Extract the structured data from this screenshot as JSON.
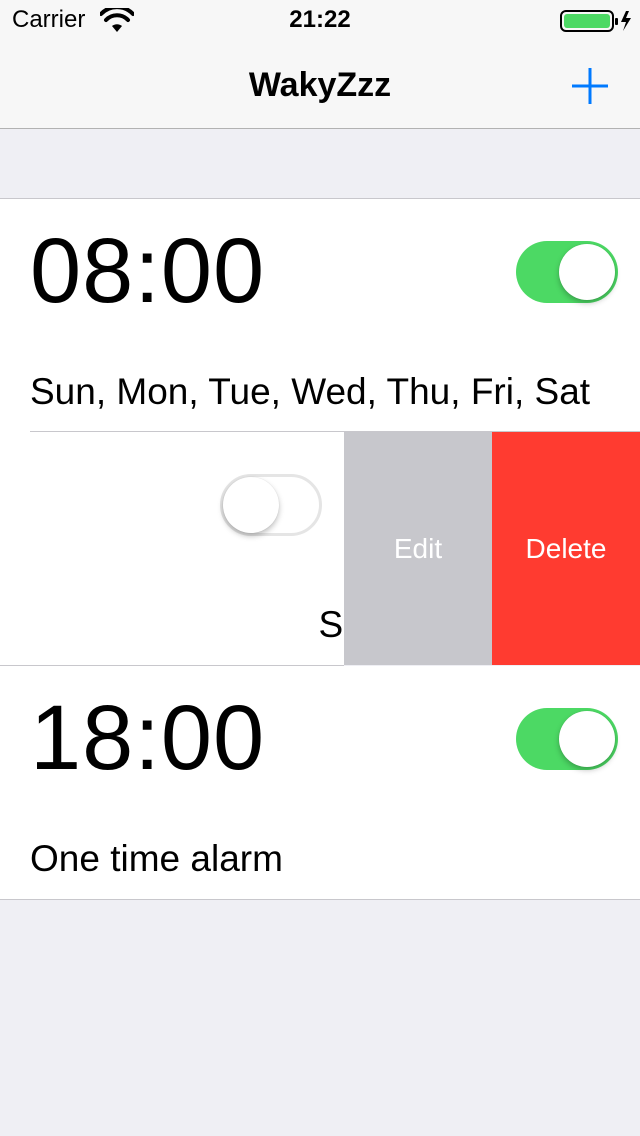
{
  "status_bar": {
    "carrier": "Carrier",
    "time": "21:22",
    "wifi_icon": "wifi-icon",
    "battery_icon": "battery-charging-icon",
    "battery_color": "#4cd964"
  },
  "nav": {
    "title": "WakyZzz",
    "add_icon": "plus-icon",
    "accent_color": "#007aff"
  },
  "alarms": [
    {
      "time": "08:00",
      "days": "Sun, Mon, Tue, Wed, Thu, Fri, Sat",
      "enabled": true
    },
    {
      "time": "",
      "days": "Sat",
      "enabled": false,
      "swiped": true
    },
    {
      "time": "18:00",
      "days": "One time alarm",
      "enabled": true
    }
  ],
  "swipe_actions": {
    "edit_label": "Edit",
    "delete_label": "Delete",
    "edit_color": "#c7c7cc",
    "delete_color": "#ff3b30"
  }
}
